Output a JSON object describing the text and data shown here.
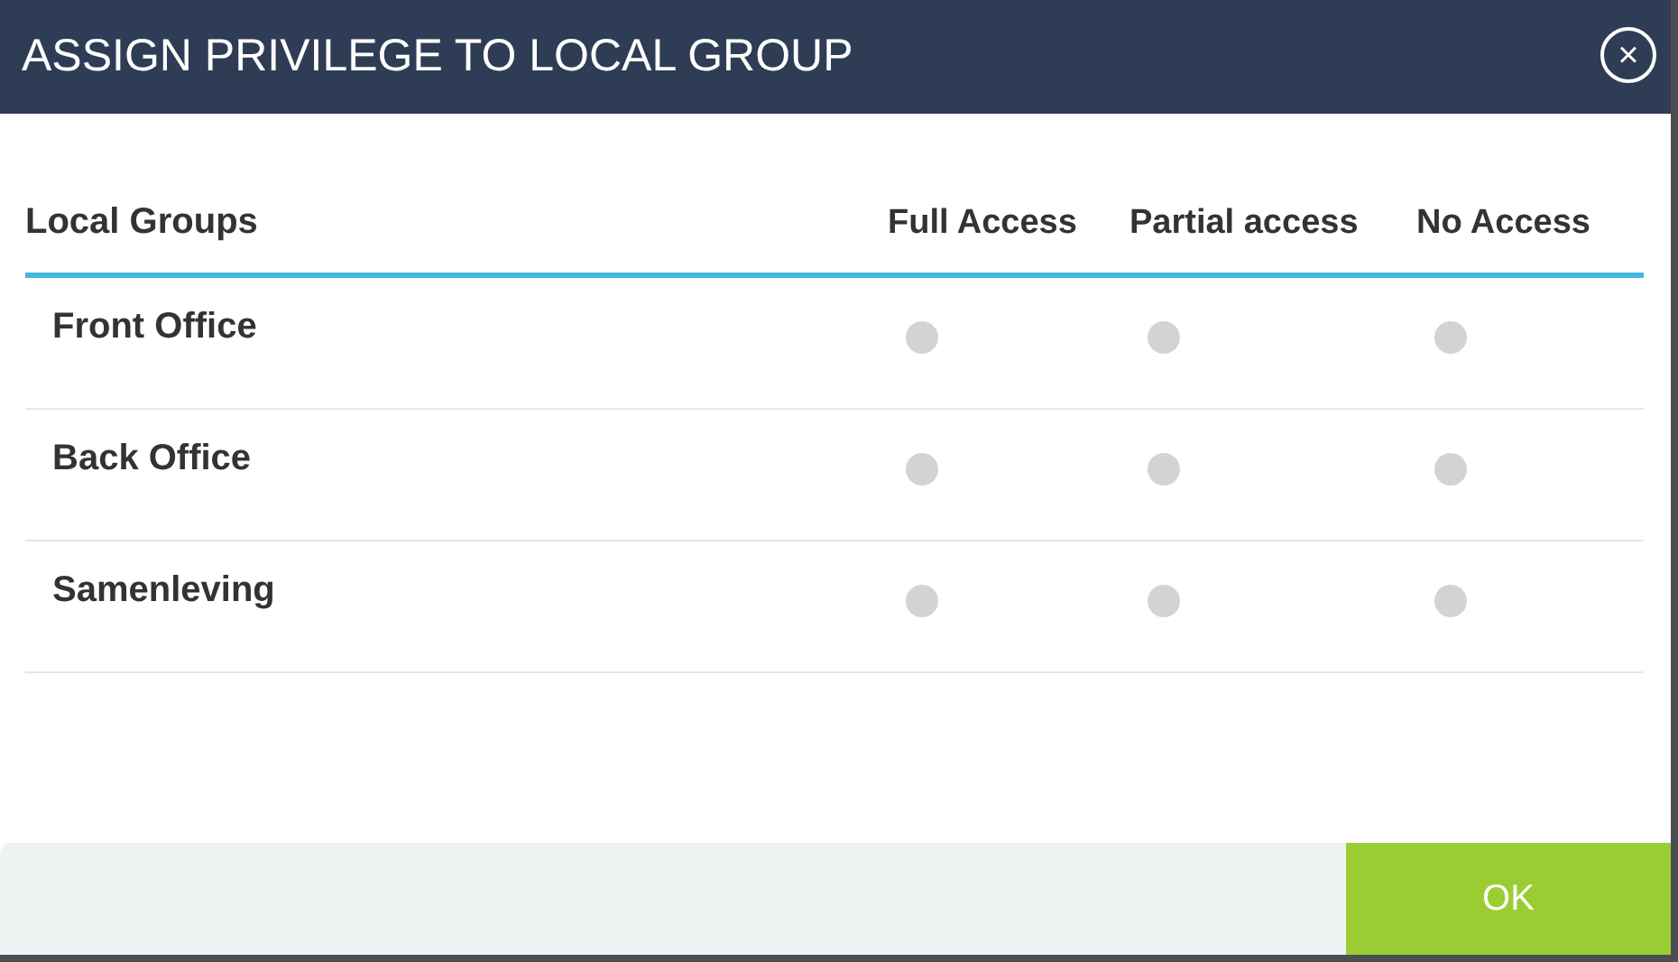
{
  "dialog": {
    "title": "ASSIGN PRIVILEGE TO LOCAL GROUP",
    "close": "×"
  },
  "table": {
    "columns": [
      "Local Groups",
      "Full Access",
      "Partial access",
      "No Access"
    ],
    "rows": [
      {
        "name": "Front Office",
        "options": [
          {
            "selected": false
          },
          {
            "selected": false
          },
          {
            "selected": false
          }
        ]
      },
      {
        "name": "Back Office",
        "options": [
          {
            "selected": false
          },
          {
            "selected": false
          },
          {
            "selected": false
          }
        ]
      },
      {
        "name": "Samenleving",
        "options": [
          {
            "selected": false
          },
          {
            "selected": false
          },
          {
            "selected": false
          }
        ]
      }
    ]
  },
  "buttons": [
    {
      "label": "OK"
    }
  ]
}
